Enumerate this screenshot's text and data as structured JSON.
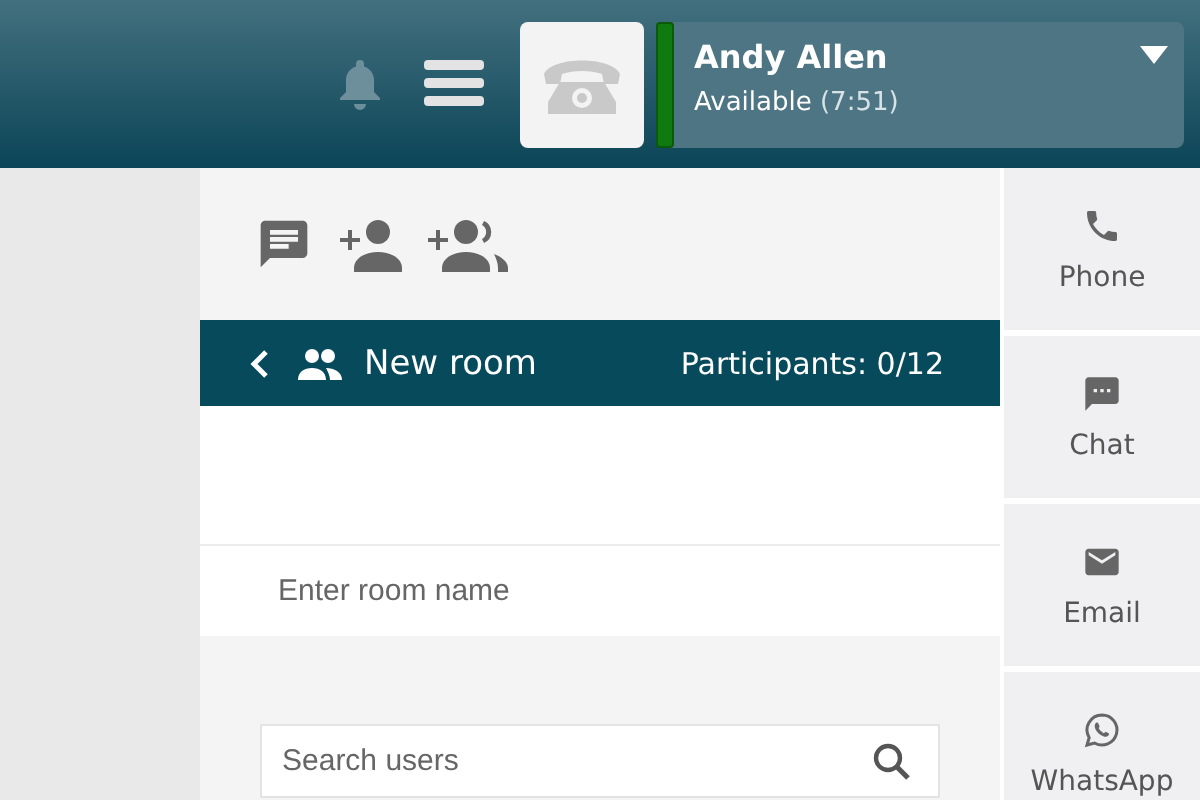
{
  "header": {
    "user_name": "Andy Allen",
    "status": "Available",
    "status_time": "(7:51)"
  },
  "room_bar": {
    "title": "New room",
    "participants": "Participants: 0/12"
  },
  "room_name": {
    "placeholder": "Enter room name"
  },
  "search": {
    "placeholder": "Search users"
  },
  "channels": [
    {
      "kind": "phone",
      "label": "Phone"
    },
    {
      "kind": "chat",
      "label": "Chat"
    },
    {
      "kind": "email",
      "label": "Email"
    },
    {
      "kind": "whatsapp",
      "label": "WhatsApp"
    }
  ]
}
